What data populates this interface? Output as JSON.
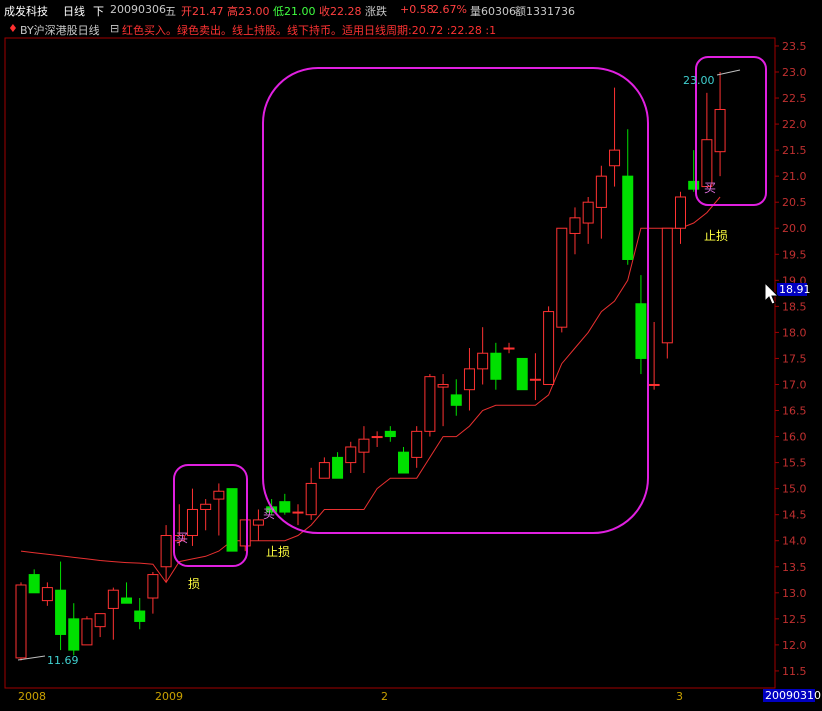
{
  "header": {
    "stock_name": "成发科技",
    "period": "日线",
    "direction": "下",
    "date": "20090306",
    "weekday": "五",
    "open": "开21.47",
    "high": "高23.00",
    "low": "低21.00",
    "close": "收22.28",
    "change_label": "涨跌",
    "change": "+0.58",
    "change_pct": "2.67%",
    "volume": "量60306",
    "amount": "额1331736"
  },
  "indicator": {
    "icon": "red-diamond-icon",
    "name": "BY沪深港股日线",
    "toggle": "⊟",
    "description": "红色买入。绿色卖出。线上持股。线下持币。适用日线周期:20.72 :22.28 :1"
  },
  "colors": {
    "up": "#ff3232",
    "down": "#00e000",
    "frame": "#a00000",
    "box": "#e020e0",
    "stop_line": "#e83030",
    "axis_text": "#c03030",
    "date_text": "#c8a000",
    "buy_text": "#e070e0",
    "stop_text": "#ffff40"
  },
  "chart_data": {
    "type": "candlestick",
    "y_range": [
      11.3,
      23.6
    ],
    "y_ticks": [
      "11.5",
      "12.0",
      "12.5",
      "13.0",
      "13.5",
      "14.0",
      "14.5",
      "15.0",
      "15.5",
      "16.0",
      "16.5",
      "17.0",
      "17.5",
      "18.0",
      "18.5",
      "19.0",
      "19.5",
      "20.0",
      "20.5",
      "21.0",
      "21.5",
      "22.0",
      "22.5",
      "23.0",
      "23.5"
    ],
    "x_labels": [
      "2008",
      "2009",
      "2",
      "3"
    ],
    "current_date_label": "20090310",
    "cursor_price_label": "18.91",
    "candles": [
      {
        "o": 11.75,
        "h": 13.2,
        "l": 11.7,
        "c": 13.15
      },
      {
        "o": 13.35,
        "h": 13.45,
        "l": 13.0,
        "c": 13.0
      },
      {
        "o": 12.85,
        "h": 13.2,
        "l": 12.75,
        "c": 13.1
      },
      {
        "o": 13.05,
        "h": 13.6,
        "l": 11.9,
        "c": 12.2
      },
      {
        "o": 12.5,
        "h": 12.8,
        "l": 11.8,
        "c": 11.9
      },
      {
        "o": 12.0,
        "h": 12.55,
        "l": 12.0,
        "c": 12.5
      },
      {
        "o": 12.35,
        "h": 12.6,
        "l": 12.15,
        "c": 12.6
      },
      {
        "o": 12.7,
        "h": 13.1,
        "l": 12.1,
        "c": 13.05
      },
      {
        "o": 12.9,
        "h": 13.2,
        "l": 12.8,
        "c": 12.8
      },
      {
        "o": 12.65,
        "h": 12.9,
        "l": 12.3,
        "c": 12.45
      },
      {
        "o": 12.9,
        "h": 13.4,
        "l": 12.6,
        "c": 13.35
      },
      {
        "o": 13.5,
        "h": 14.3,
        "l": 13.2,
        "c": 14.1
      },
      {
        "o": 14.0,
        "h": 14.7,
        "l": 13.9,
        "c": 14.1
      },
      {
        "o": 14.1,
        "h": 15.0,
        "l": 13.9,
        "c": 14.6
      },
      {
        "o": 14.6,
        "h": 14.8,
        "l": 14.2,
        "c": 14.7
      },
      {
        "o": 14.8,
        "h": 15.1,
        "l": 14.1,
        "c": 14.95
      },
      {
        "o": 15.0,
        "h": 15.0,
        "l": 13.8,
        "c": 13.8
      },
      {
        "o": 13.9,
        "h": 14.4,
        "l": 13.8,
        "c": 14.4
      },
      {
        "o": 14.3,
        "h": 14.6,
        "l": 14.0,
        "c": 14.4
      },
      {
        "o": 14.65,
        "h": 14.8,
        "l": 14.5,
        "c": 14.55
      },
      {
        "o": 14.75,
        "h": 14.9,
        "l": 14.5,
        "c": 14.55
      },
      {
        "o": 14.55,
        "h": 14.7,
        "l": 14.3,
        "c": 14.55
      },
      {
        "o": 14.5,
        "h": 15.4,
        "l": 14.4,
        "c": 15.1
      },
      {
        "o": 15.2,
        "h": 15.6,
        "l": 15.2,
        "c": 15.5
      },
      {
        "o": 15.6,
        "h": 15.7,
        "l": 15.2,
        "c": 15.2
      },
      {
        "o": 15.5,
        "h": 15.9,
        "l": 15.3,
        "c": 15.8
      },
      {
        "o": 15.7,
        "h": 16.2,
        "l": 15.3,
        "c": 15.95
      },
      {
        "o": 16.0,
        "h": 16.1,
        "l": 15.8,
        "c": 16.0
      },
      {
        "o": 16.1,
        "h": 16.2,
        "l": 15.9,
        "c": 16.0
      },
      {
        "o": 15.7,
        "h": 15.8,
        "l": 15.3,
        "c": 15.3
      },
      {
        "o": 15.6,
        "h": 16.2,
        "l": 15.4,
        "c": 16.1
      },
      {
        "o": 16.1,
        "h": 17.2,
        "l": 16.0,
        "c": 17.15
      },
      {
        "o": 16.95,
        "h": 17.2,
        "l": 16.2,
        "c": 17.0
      },
      {
        "o": 16.8,
        "h": 17.1,
        "l": 16.4,
        "c": 16.6
      },
      {
        "o": 16.9,
        "h": 17.7,
        "l": 16.5,
        "c": 17.3
      },
      {
        "o": 17.3,
        "h": 18.1,
        "l": 17.0,
        "c": 17.6
      },
      {
        "o": 17.6,
        "h": 17.8,
        "l": 16.9,
        "c": 17.1
      },
      {
        "o": 17.7,
        "h": 17.8,
        "l": 17.6,
        "c": 17.7
      },
      {
        "o": 17.5,
        "h": 17.5,
        "l": 16.9,
        "c": 16.9
      },
      {
        "o": 17.1,
        "h": 17.6,
        "l": 16.7,
        "c": 17.1
      },
      {
        "o": 17.0,
        "h": 18.5,
        "l": 17.0,
        "c": 18.4
      },
      {
        "o": 18.1,
        "h": 20.0,
        "l": 18.0,
        "c": 20.0
      },
      {
        "o": 19.9,
        "h": 20.4,
        "l": 19.5,
        "c": 20.2
      },
      {
        "o": 20.1,
        "h": 20.6,
        "l": 19.7,
        "c": 20.5
      },
      {
        "o": 20.4,
        "h": 21.2,
        "l": 19.8,
        "c": 21.0
      },
      {
        "o": 21.2,
        "h": 22.7,
        "l": 20.8,
        "c": 21.5
      },
      {
        "o": 21.0,
        "h": 21.9,
        "l": 19.3,
        "c": 19.4
      },
      {
        "o": 18.55,
        "h": 19.1,
        "l": 17.2,
        "c": 17.5
      },
      {
        "o": 17.0,
        "h": 18.2,
        "l": 16.9,
        "c": 17.0
      },
      {
        "o": 17.8,
        "h": 20.0,
        "l": 17.5,
        "c": 20.0
      },
      {
        "o": 20.0,
        "h": 20.7,
        "l": 19.7,
        "c": 20.6
      },
      {
        "o": 20.9,
        "h": 21.5,
        "l": 20.7,
        "c": 20.75
      },
      {
        "o": 20.8,
        "h": 22.6,
        "l": 20.8,
        "c": 21.7
      },
      {
        "o": 21.47,
        "h": 23.0,
        "l": 21.0,
        "c": 22.28
      }
    ],
    "stop_line": [
      13.8,
      13.77,
      13.74,
      13.71,
      13.68,
      13.65,
      13.62,
      13.6,
      13.58,
      13.57,
      13.55,
      13.2,
      13.6,
      13.65,
      13.7,
      13.8,
      14.0,
      14.0,
      14.0,
      14.0,
      14.0,
      14.1,
      14.3,
      14.6,
      14.6,
      14.6,
      14.6,
      15.0,
      15.2,
      15.2,
      15.2,
      15.6,
      16.0,
      16.0,
      16.2,
      16.5,
      16.6,
      16.6,
      16.6,
      16.6,
      16.8,
      17.4,
      17.7,
      18.0,
      18.4,
      18.6,
      19.0,
      20.0,
      20.0,
      20.0,
      20.0,
      20.1,
      20.3,
      20.6
    ],
    "annotations": [
      {
        "text": "11.69",
        "kind": "min"
      },
      {
        "text": "23.00",
        "kind": "max"
      },
      {
        "text": "买",
        "kind": "buy"
      },
      {
        "text": "买",
        "kind": "buy"
      },
      {
        "text": "买",
        "kind": "buy"
      },
      {
        "text": "损",
        "kind": "stop"
      },
      {
        "text": "止损",
        "kind": "stop"
      },
      {
        "text": "止损",
        "kind": "stop"
      }
    ]
  }
}
